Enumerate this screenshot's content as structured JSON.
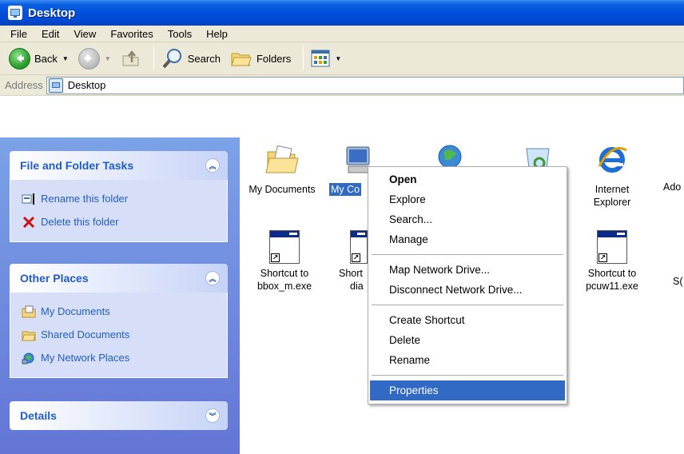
{
  "window": {
    "title": "Desktop"
  },
  "menubar": {
    "items": [
      "File",
      "Edit",
      "View",
      "Favorites",
      "Tools",
      "Help"
    ]
  },
  "toolbar": {
    "back_label": "Back",
    "search_label": "Search",
    "folders_label": "Folders"
  },
  "address": {
    "label": "Address",
    "value": "Desktop"
  },
  "left_pane": {
    "file_tasks": {
      "title": "File and Folder Tasks",
      "items": [
        "Rename this folder",
        "Delete this folder"
      ]
    },
    "other_places": {
      "title": "Other Places",
      "items": [
        "My Documents",
        "Shared Documents",
        "My Network Places"
      ]
    },
    "details": {
      "title": "Details"
    }
  },
  "desktop_items": {
    "my_documents": "My Documents",
    "my_computer": "My Co",
    "internet_explorer": [
      "Internet",
      "Explorer"
    ],
    "partial_ado": "Ado",
    "shortcut_bbox": [
      "Shortcut to",
      "bbox_m.exe"
    ],
    "shortcut_partial": [
      "Short",
      "dia"
    ],
    "shortcut_pcuw": [
      "Shortcut to",
      "pcuw11.exe"
    ],
    "partial_s": "S("
  },
  "context_menu": {
    "groups": [
      [
        "Open",
        "Explore",
        "Search...",
        "Manage"
      ],
      [
        "Map Network Drive...",
        "Disconnect Network Drive..."
      ],
      [
        "Create Shortcut",
        "Delete",
        "Rename"
      ],
      [
        "Properties"
      ]
    ],
    "default_item": "Open",
    "highlighted_item": "Properties"
  },
  "colors": {
    "titlebar": "#0050dc",
    "selection": "#316ac5",
    "task_link": "#215dc6",
    "pane_bg": "#7ba2e7"
  }
}
